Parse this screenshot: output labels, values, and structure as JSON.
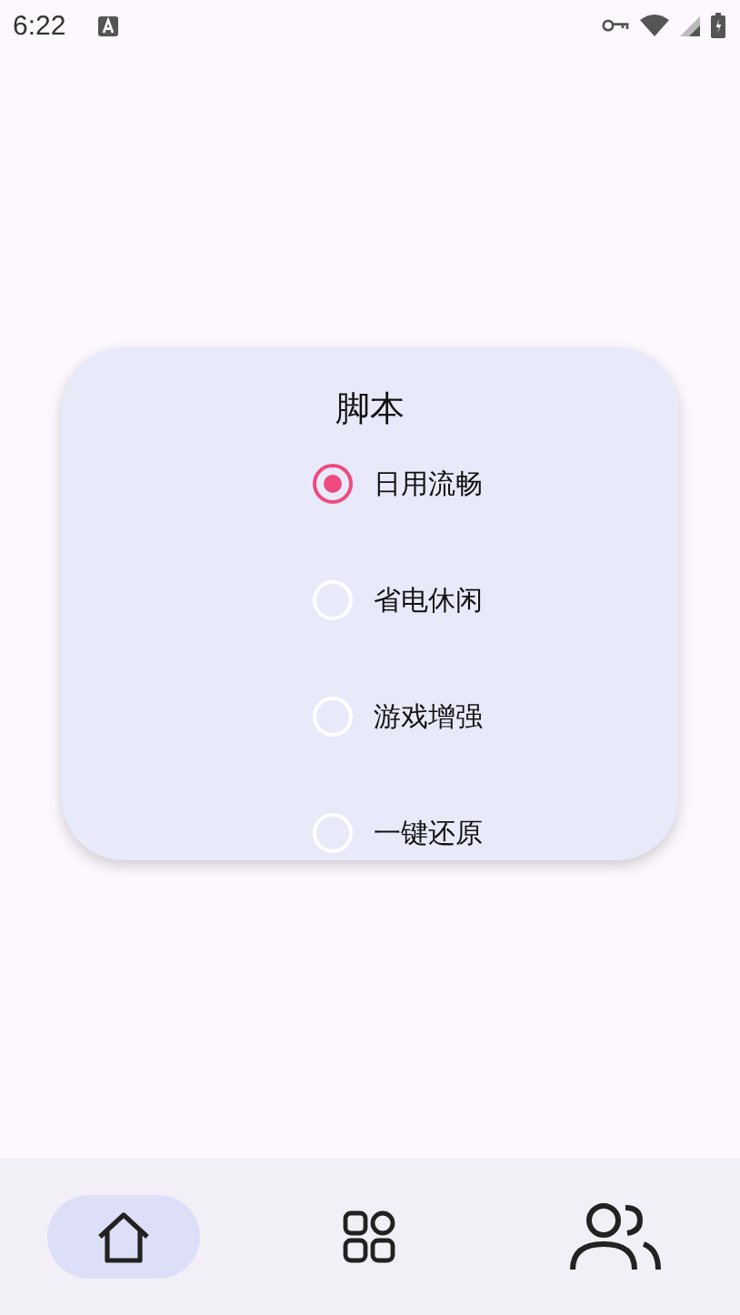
{
  "status_bar": {
    "time": "6:22"
  },
  "dialog": {
    "title": "脚本",
    "options": [
      {
        "label": "日用流畅",
        "selected": true
      },
      {
        "label": "省电休闲",
        "selected": false
      },
      {
        "label": "游戏增强",
        "selected": false
      },
      {
        "label": "一键还原",
        "selected": false
      }
    ]
  },
  "bottom_nav": [
    {
      "kind": "home",
      "selected": true
    },
    {
      "kind": "tools",
      "selected": false
    },
    {
      "kind": "people",
      "selected": false
    }
  ]
}
